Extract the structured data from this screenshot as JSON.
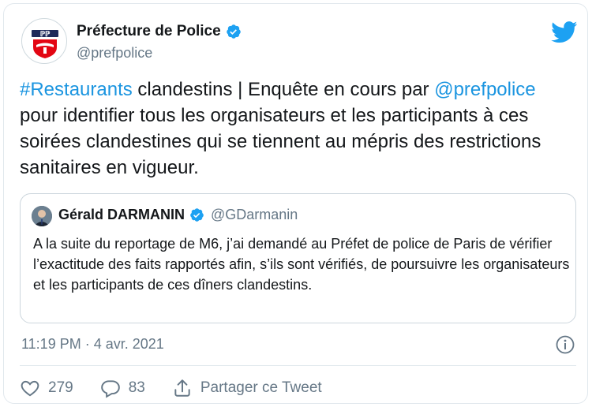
{
  "author": {
    "name": "Préfecture de Police",
    "handle": "@prefpolice",
    "logo_text": "PP"
  },
  "tweet": {
    "hashtag": "#Restaurants",
    "text_1": " clandestins | Enquête en cours par ",
    "mention": "@prefpolice",
    "text_2": " pour identifier tous les organisateurs et les participants à ces soirées clandestines qui se tiennent au mépris des restrictions sanitaires en vigueur."
  },
  "quoted": {
    "name": "Gérald DARMANIN",
    "handle": "@GDarmanin",
    "text": "A la suite du reportage de M6, j’ai demandé au Préfet de police de Paris de vérifier l’exactitude des faits rapportés afin, s’ils sont vérifiés, de poursuivre les organisateurs et les participants de ces dîners clandestins."
  },
  "timestamp": "11:19 PM · 4 avr. 2021",
  "actions": {
    "likes": "279",
    "replies": "83",
    "share_label": "Partager ce Tweet"
  },
  "colors": {
    "link": "#1b95e0",
    "verified": "#1da1f2",
    "muted": "#657786",
    "border": "#e1e8ed"
  },
  "icons": [
    "verified-badge-icon",
    "twitter-bird-icon",
    "info-icon",
    "heart-icon",
    "reply-icon",
    "share-icon"
  ]
}
